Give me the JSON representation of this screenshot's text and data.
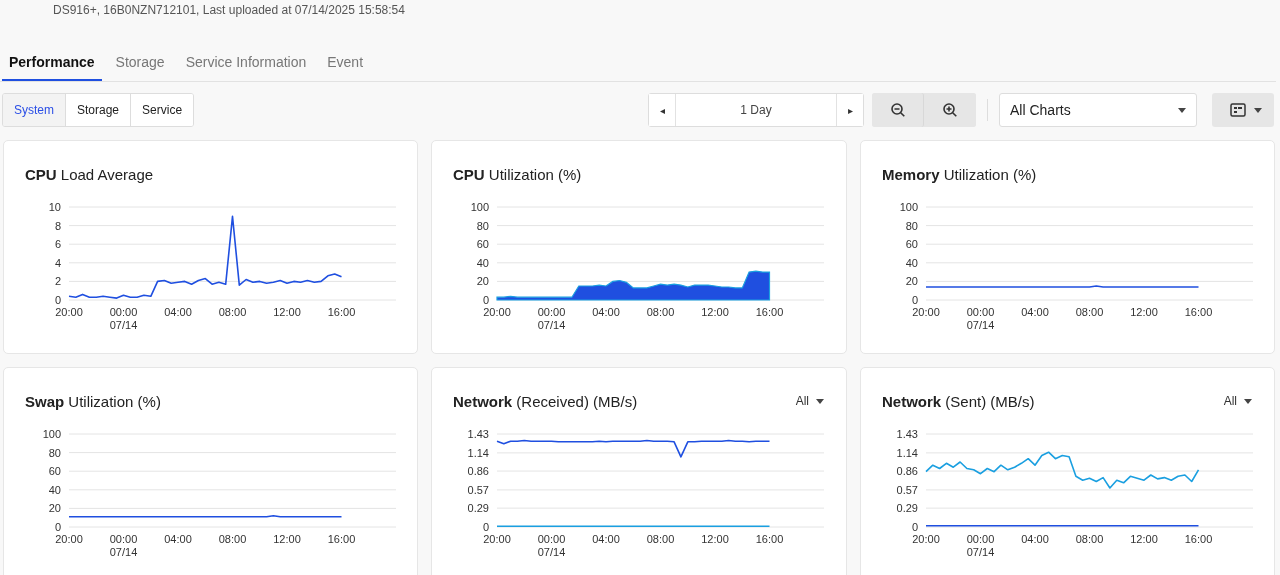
{
  "header": {
    "subtitle": "DS916+, 16B0NZN712101, Last uploaded at 07/14/2025 15:58:54"
  },
  "tabs": [
    {
      "label": "Performance",
      "selected": true
    },
    {
      "label": "Storage",
      "selected": false
    },
    {
      "label": "Service Information",
      "selected": false
    },
    {
      "label": "Event",
      "selected": false
    }
  ],
  "segments": [
    {
      "label": "System",
      "selected": true
    },
    {
      "label": "Storage",
      "selected": false
    },
    {
      "label": "Service",
      "selected": false
    }
  ],
  "range": {
    "prev": "◂",
    "label": "1 Day",
    "next": "▸"
  },
  "chart_select": {
    "value": "All Charts"
  },
  "cards": [
    {
      "chart_data": {
        "type": "line",
        "title": "**CPU** Load Average",
        "grid": true,
        "ylim": [
          0,
          10
        ],
        "yticks": [
          0,
          2,
          4,
          6,
          8,
          10
        ],
        "categories": [
          "20:00",
          null,
          null,
          null,
          null,
          null,
          null,
          null,
          "00:00\n07/14",
          null,
          null,
          null,
          null,
          null,
          null,
          null,
          "04:00",
          null,
          null,
          null,
          null,
          null,
          null,
          null,
          "08:00",
          null,
          null,
          null,
          null,
          null,
          null,
          null,
          "12:00",
          null,
          null,
          null,
          null,
          null,
          null,
          null,
          "16:00"
        ],
        "series": [
          {
            "color": "#1f4fe0",
            "values": [
              0.4,
              0.3,
              0.6,
              0.3,
              0.3,
              0.4,
              0.3,
              0.2,
              0.5,
              0.3,
              0.3,
              0.5,
              0.4,
              2.0,
              2.1,
              1.8,
              1.9,
              2.0,
              1.7,
              2.1,
              2.3,
              1.7,
              1.9,
              1.7,
              9.0,
              1.6,
              2.2,
              1.9,
              2.0,
              1.8,
              1.9,
              2.1,
              1.8,
              2.0,
              1.9,
              2.1,
              1.9,
              2.0,
              2.6,
              2.8,
              2.5
            ]
          }
        ]
      }
    },
    {
      "chart_data": {
        "type": "area",
        "title": "**CPU** Utilization (%)",
        "grid": true,
        "ylim": [
          0,
          100
        ],
        "yticks": [
          0,
          20,
          40,
          60,
          80,
          100
        ],
        "categories": [
          "20:00",
          null,
          null,
          null,
          null,
          null,
          null,
          null,
          "00:00\n07/14",
          null,
          null,
          null,
          null,
          null,
          null,
          null,
          "04:00",
          null,
          null,
          null,
          null,
          null,
          null,
          null,
          "08:00",
          null,
          null,
          null,
          null,
          null,
          null,
          null,
          "12:00",
          null,
          null,
          null,
          null,
          null,
          null,
          null,
          "16:00"
        ],
        "series": [
          {
            "color": "#1f4fe0",
            "values": [
              3,
              3,
              4,
              3,
              3,
              3,
              3,
              3,
              3,
              3,
              3,
              3,
              15,
              15,
              15,
              16,
              15,
              20,
              21,
              19,
              13,
              13,
              13,
              15,
              17,
              16,
              17,
              16,
              14,
              16,
              16,
              16,
              15,
              14,
              14,
              13,
              13,
              30,
              31,
              30,
              30
            ]
          }
        ]
      }
    },
    {
      "chart_data": {
        "type": "line",
        "title": "**Memory** Utilization (%)",
        "grid": true,
        "ylim": [
          0,
          100
        ],
        "yticks": [
          0,
          20,
          40,
          60,
          80,
          100
        ],
        "categories": [
          "20:00",
          null,
          null,
          null,
          null,
          null,
          null,
          null,
          "00:00\n07/14",
          null,
          null,
          null,
          null,
          null,
          null,
          null,
          "04:00",
          null,
          null,
          null,
          null,
          null,
          null,
          null,
          "08:00",
          null,
          null,
          null,
          null,
          null,
          null,
          null,
          "12:00",
          null,
          null,
          null,
          null,
          null,
          null,
          null,
          "16:00"
        ],
        "series": [
          {
            "color": "#1f4fe0",
            "values": [
              14,
              14,
              14,
              14,
              14,
              14,
              14,
              14,
              14,
              14,
              14,
              14,
              14,
              14,
              14,
              14,
              14,
              14,
              14,
              14,
              14,
              14,
              14,
              14,
              14,
              15,
              14,
              14,
              14,
              14,
              14,
              14,
              14,
              14,
              14,
              14,
              14,
              14,
              14,
              14,
              14
            ]
          }
        ]
      }
    },
    {
      "chart_data": {
        "type": "line",
        "title": "**Swap** Utilization (%)",
        "grid": true,
        "ylim": [
          0,
          100
        ],
        "yticks": [
          0,
          20,
          40,
          60,
          80,
          100
        ],
        "categories": [
          "20:00",
          null,
          null,
          null,
          null,
          null,
          null,
          null,
          "00:00\n07/14",
          null,
          null,
          null,
          null,
          null,
          null,
          null,
          "04:00",
          null,
          null,
          null,
          null,
          null,
          null,
          null,
          "08:00",
          null,
          null,
          null,
          null,
          null,
          null,
          null,
          "12:00",
          null,
          null,
          null,
          null,
          null,
          null,
          null,
          "16:00"
        ],
        "series": [
          {
            "color": "#1f4fe0",
            "values": [
              11,
              11,
              11,
              11,
              11,
              11,
              11,
              11,
              11,
              11,
              11,
              11,
              11,
              11,
              11,
              11,
              11,
              11,
              11,
              11,
              11,
              11,
              11,
              11,
              11,
              11,
              11,
              11,
              11,
              11,
              12,
              11,
              11,
              11,
              11,
              11,
              11,
              11,
              11,
              11,
              11
            ]
          }
        ]
      }
    },
    {
      "filter": "All",
      "chart_data": {
        "type": "line",
        "title": "**Network** (Received) (MB/s)",
        "grid": true,
        "ylim": [
          0,
          1.43
        ],
        "yticks": [
          0,
          0.29,
          0.57,
          0.86,
          1.14,
          1.43
        ],
        "categories": [
          "20:00",
          null,
          null,
          null,
          null,
          null,
          null,
          null,
          "00:00\n07/14",
          null,
          null,
          null,
          null,
          null,
          null,
          null,
          "04:00",
          null,
          null,
          null,
          null,
          null,
          null,
          null,
          "08:00",
          null,
          null,
          null,
          null,
          null,
          null,
          null,
          "12:00",
          null,
          null,
          null,
          null,
          null,
          null,
          null,
          "16:00"
        ],
        "series": [
          {
            "color": "#1f4fe0",
            "values": [
              1.32,
              1.28,
              1.32,
              1.32,
              1.33,
              1.32,
              1.32,
              1.32,
              1.32,
              1.31,
              1.31,
              1.31,
              1.31,
              1.31,
              1.31,
              1.32,
              1.31,
              1.32,
              1.32,
              1.32,
              1.32,
              1.32,
              1.33,
              1.32,
              1.32,
              1.32,
              1.31,
              1.08,
              1.31,
              1.31,
              1.32,
              1.32,
              1.32,
              1.32,
              1.33,
              1.32,
              1.32,
              1.31,
              1.32,
              1.32,
              1.32
            ]
          },
          {
            "color": "#1a9fe0",
            "values": [
              0.01,
              0.01,
              0.01,
              0.01,
              0.01,
              0.01,
              0.01,
              0.01,
              0.01,
              0.01,
              0.01,
              0.01,
              0.01,
              0.01,
              0.01,
              0.01,
              0.01,
              0.01,
              0.01,
              0.01,
              0.01,
              0.01,
              0.01,
              0.01,
              0.01,
              0.01,
              0.01,
              0.01,
              0.01,
              0.01,
              0.01,
              0.01,
              0.01,
              0.01,
              0.01,
              0.01,
              0.01,
              0.01,
              0.01,
              0.01,
              0.01
            ]
          }
        ]
      }
    },
    {
      "filter": "All",
      "chart_data": {
        "type": "line",
        "title": "**Network** (Sent) (MB/s)",
        "grid": true,
        "ylim": [
          0,
          1.43
        ],
        "yticks": [
          0,
          0.29,
          0.57,
          0.86,
          1.14,
          1.43
        ],
        "categories": [
          "20:00",
          null,
          null,
          null,
          null,
          null,
          null,
          null,
          "00:00\n07/14",
          null,
          null,
          null,
          null,
          null,
          null,
          null,
          "04:00",
          null,
          null,
          null,
          null,
          null,
          null,
          null,
          "08:00",
          null,
          null,
          null,
          null,
          null,
          null,
          null,
          "12:00",
          null,
          null,
          null,
          null,
          null,
          null,
          null,
          "16:00"
        ],
        "series": [
          {
            "color": "#1a9fe0",
            "values": [
              0.85,
              0.95,
              0.9,
              0.98,
              0.92,
              1.0,
              0.9,
              0.88,
              0.82,
              0.9,
              0.85,
              0.95,
              0.88,
              0.92,
              0.98,
              1.05,
              0.95,
              1.1,
              1.15,
              1.05,
              1.1,
              1.08,
              0.78,
              0.72,
              0.75,
              0.7,
              0.76,
              0.6,
              0.72,
              0.68,
              0.78,
              0.75,
              0.72,
              0.8,
              0.74,
              0.76,
              0.72,
              0.78,
              0.8,
              0.7,
              0.88
            ]
          },
          {
            "color": "#1f4fe0",
            "values": [
              0.02,
              0.02,
              0.02,
              0.02,
              0.02,
              0.02,
              0.02,
              0.02,
              0.02,
              0.02,
              0.02,
              0.02,
              0.02,
              0.02,
              0.02,
              0.02,
              0.02,
              0.02,
              0.02,
              0.02,
              0.02,
              0.02,
              0.02,
              0.02,
              0.02,
              0.02,
              0.02,
              0.02,
              0.02,
              0.02,
              0.02,
              0.02,
              0.02,
              0.02,
              0.02,
              0.02,
              0.02,
              0.02,
              0.02,
              0.02,
              0.02
            ]
          }
        ]
      }
    }
  ]
}
